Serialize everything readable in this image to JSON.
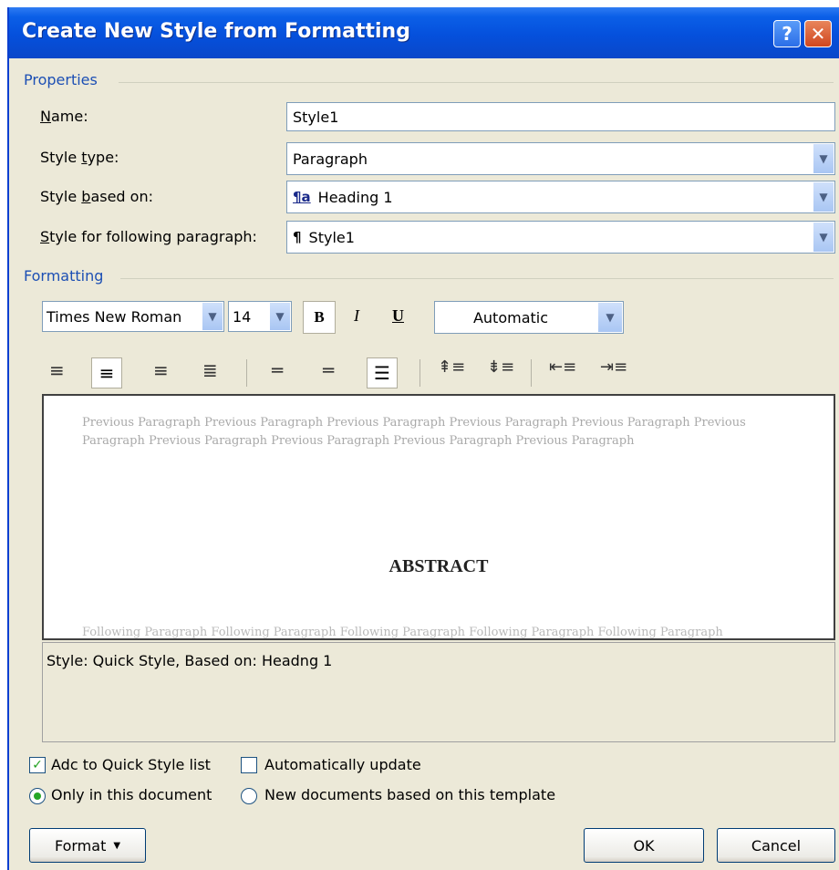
{
  "window": {
    "title": "Create New Style from Formatting"
  },
  "properties": {
    "group_label": "Properties",
    "name_label": "Name:",
    "name_value": "Style1",
    "style_type_label": "Style type:",
    "style_type_value": "Paragraph",
    "based_on_label": "Style based on:",
    "based_on_value": "Heading 1",
    "following_label": "Style for following paragraph:",
    "following_value": "Style1"
  },
  "formatting": {
    "group_label": "Formatting",
    "font": "Times New Roman",
    "size": "14",
    "bold": "B",
    "italic": "I",
    "underline": "U",
    "color": "Automatic"
  },
  "preview": {
    "previous_text": "Previous Paragraph Previous Paragraph Previous Paragraph Previous Paragraph Previous Paragraph Previous Paragraph Previous Paragraph Previous Paragraph Previous Paragraph Previous Paragraph",
    "sample_text": "ABSTRACT",
    "following_text": "Following Paragraph Following Paragraph Following Paragraph Following Paragraph Following Paragraph"
  },
  "description": "Style: Quick Style, Based on: Headng 1",
  "options": {
    "add_quick_style": "Adc to Quick Style list",
    "auto_update": "Automatically update",
    "only_this_doc": "Only in this document",
    "new_docs": "New documents based on this template"
  },
  "buttons": {
    "format": "Format",
    "ok": "OK",
    "cancel": "Cancel"
  }
}
